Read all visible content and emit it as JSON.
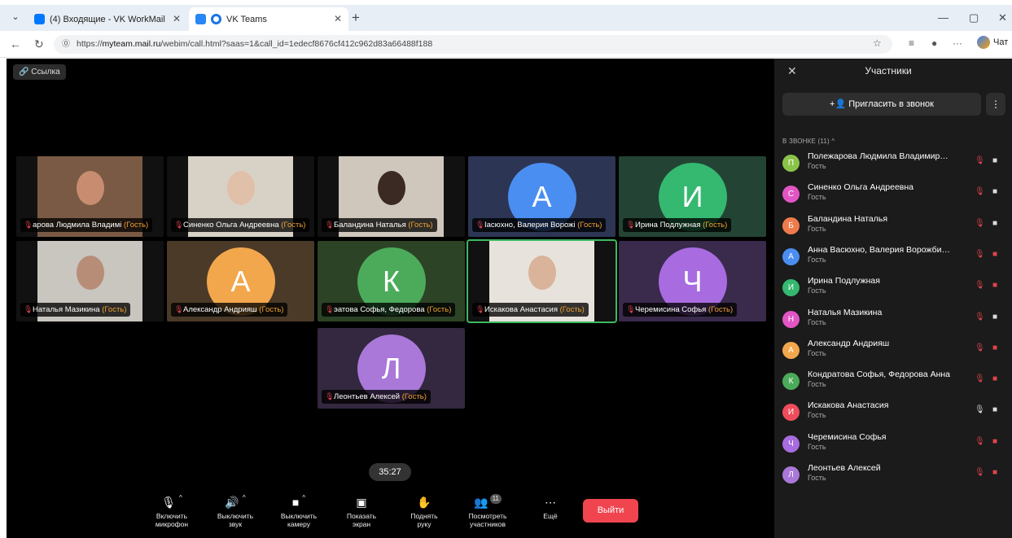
{
  "browser": {
    "tabs": [
      {
        "title": "(4) Входящие - VK WorkMail",
        "color": "#0077ff"
      },
      {
        "title": "VK Teams",
        "color": "#2787f5"
      }
    ],
    "url_prefix": "https://",
    "url_domain": "myteam.mail.ru",
    "url_path": "/webim/call.html?saas=1&call_id=1edecf8676cf412c962d83a66488f188",
    "chat_label": "Чат"
  },
  "call": {
    "link_label": "Ссылка",
    "timer": "35:27",
    "guest_tag": "(Гость)",
    "tiles": [
      {
        "name": "арова Людмила Владимі",
        "type": "video",
        "bg": "#7a5a44",
        "face": "#c88d70"
      },
      {
        "name": "Синенко Ольга Андреевна",
        "type": "video",
        "bg": "#d8d2c6",
        "face": "#e1c0aa"
      },
      {
        "name": "Баландина Наталья",
        "type": "video",
        "bg": "#cfc6bc",
        "face": "#3b2a24"
      },
      {
        "name": "Іасюхно, Валерия Ворожі",
        "type": "avatar",
        "bg": "#2c3553",
        "letter": "А",
        "color": "#4b8ef1"
      },
      {
        "name": "Ирина Подлужная",
        "type": "avatar",
        "bg": "#234434",
        "letter": "И",
        "color": "#35b870"
      },
      {
        "name": "Наталья Мазикина",
        "type": "video",
        "bg": "#c9c5bf",
        "face": "#b88d78"
      },
      {
        "name": "Александр Андрияш",
        "type": "avatar",
        "bg": "#4b3a28",
        "letter": "А",
        "color": "#f2a74d"
      },
      {
        "name": "эатова Софья, Федорова",
        "type": "avatar",
        "bg": "#2c4326",
        "letter": "К",
        "color": "#4cab5a"
      },
      {
        "name": "Искакова Анастасия",
        "type": "video",
        "bg": "#e8e2dc",
        "face": "#d9b39a"
      },
      {
        "name": "Черемисина Софья",
        "type": "avatar",
        "bg": "#3a2a4c",
        "letter": "Ч",
        "color": "#a86be0"
      },
      {
        "name": "Леонтьев Алексей",
        "type": "avatar",
        "bg": "#33283f",
        "letter": "Л",
        "color": "#a978d8"
      }
    ],
    "controls": [
      {
        "label1": "Включить",
        "label2": "микрофон",
        "icon": "🎙"
      },
      {
        "label1": "Выключить",
        "label2": "звук",
        "icon": "🔊"
      },
      {
        "label1": "Выключить",
        "label2": "камеру",
        "icon": "■"
      },
      {
        "label1": "Показать",
        "label2": "экран",
        "icon": "▣"
      },
      {
        "label1": "Поднять",
        "label2": "руку",
        "icon": "✋"
      },
      {
        "label1": "Посмотреть",
        "label2": "участников",
        "icon": "👥",
        "badge": "11"
      },
      {
        "label1": "Ещё",
        "label2": "",
        "icon": "⋯"
      }
    ],
    "leave_label": "Выйти"
  },
  "panel": {
    "title": "Участники",
    "invite_label": "Пригласить в звонок",
    "section_label": "В ЗВОНКЕ (11) ^",
    "participants": [
      {
        "name": "Полежарова Людмила Владимир…",
        "status": "Гость",
        "letter": "П",
        "color": "#8bc34a",
        "mic": false,
        "cam": true
      },
      {
        "name": "Синенко Ольга Андреевна",
        "status": "Гость",
        "letter": "С",
        "color": "#e255c4",
        "mic": false,
        "cam": true
      },
      {
        "name": "Баландина Наталья",
        "status": "Гость",
        "letter": "Б",
        "color": "#ef7b4c",
        "mic": false,
        "cam": true
      },
      {
        "name": "Анна Васюхно, Валерия Ворожби…",
        "status": "Гость",
        "letter": "А",
        "color": "#4b8ef1",
        "mic": false,
        "cam": false
      },
      {
        "name": "Ирина Подлужная",
        "status": "Гость",
        "letter": "И",
        "color": "#35b870",
        "mic": false,
        "cam": false
      },
      {
        "name": "Наталья Мазикина",
        "status": "Гость",
        "letter": "Н",
        "color": "#e255c4",
        "mic": false,
        "cam": true
      },
      {
        "name": "Александр Андрияш",
        "status": "Гость",
        "letter": "А",
        "color": "#f2a74d",
        "mic": false,
        "cam": false
      },
      {
        "name": "Кондратова Софья, Федорова Анна",
        "status": "Гость",
        "letter": "К",
        "color": "#4cab5a",
        "mic": false,
        "cam": false
      },
      {
        "name": "Искакова Анастасия",
        "status": "Гость",
        "letter": "И",
        "color": "#ef4c5b",
        "mic": true,
        "cam": true
      },
      {
        "name": "Черемисина Софья",
        "status": "Гость",
        "letter": "Ч",
        "color": "#a86be0",
        "mic": false,
        "cam": false
      },
      {
        "name": "Леонтьев Алексей",
        "status": "Гость",
        "letter": "Л",
        "color": "#a978d8",
        "mic": false,
        "cam": false
      }
    ]
  }
}
